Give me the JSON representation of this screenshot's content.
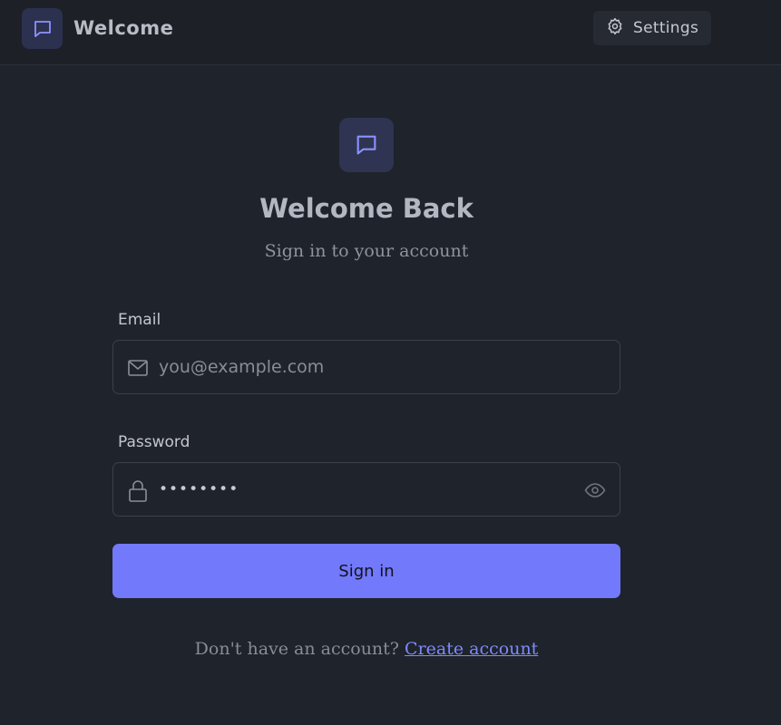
{
  "header": {
    "title": "Welcome",
    "settings_label": "Settings",
    "brand_icon": "chat-icon",
    "settings_icon": "gear-icon"
  },
  "main": {
    "hero_icon": "chat-icon",
    "title": "Welcome Back",
    "subtitle": "Sign in to your account"
  },
  "form": {
    "email": {
      "label": "Email",
      "placeholder": "you@example.com",
      "value": "",
      "icon": "mail-icon"
    },
    "password": {
      "label": "Password",
      "value": "••••••••",
      "icon": "lock-icon",
      "toggle_icon": "eye-icon"
    },
    "submit_label": "Sign in"
  },
  "footer": {
    "prompt": "Don't have an account?",
    "link": "Create account"
  },
  "colors": {
    "background": "#1f232b",
    "accent": "#7379fb",
    "link": "#7c8bff"
  }
}
